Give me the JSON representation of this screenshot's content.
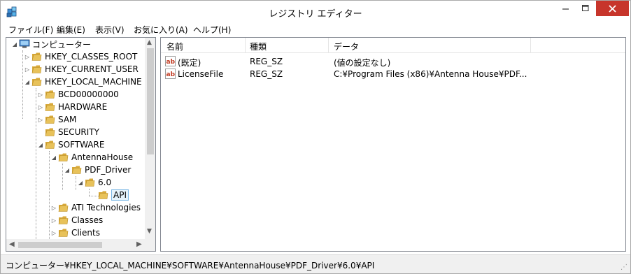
{
  "window": {
    "title": "レジストリ エディター"
  },
  "menu": {
    "items": [
      {
        "label": "ファイル(F)"
      },
      {
        "label": "編集(E)"
      },
      {
        "label": "表示(V)"
      },
      {
        "label": "お気に入り(A)"
      },
      {
        "label": "ヘルプ(H)"
      }
    ]
  },
  "tree": {
    "root": "コンピューター",
    "nodes": [
      {
        "label": "HKEY_CLASSES_ROOT",
        "expander": "▷"
      },
      {
        "label": "HKEY_CURRENT_USER",
        "expander": "▷"
      },
      {
        "label": "HKEY_LOCAL_MACHINE",
        "expander": "◢"
      },
      {
        "label": "BCD00000000",
        "expander": "▷"
      },
      {
        "label": "HARDWARE",
        "expander": "▷"
      },
      {
        "label": "SAM",
        "expander": "▷"
      },
      {
        "label": "SECURITY",
        "expander": ""
      },
      {
        "label": "SOFTWARE",
        "expander": "◢"
      },
      {
        "label": "AntennaHouse",
        "expander": "◢"
      },
      {
        "label": "PDF_Driver",
        "expander": "◢"
      },
      {
        "label": "6.0",
        "expander": "◢"
      },
      {
        "label": "API",
        "expander": ""
      },
      {
        "label": "ATI Technologies",
        "expander": "▷"
      },
      {
        "label": "Classes",
        "expander": "▷"
      },
      {
        "label": "Clients",
        "expander": "▷"
      }
    ]
  },
  "list": {
    "columns": [
      "名前",
      "種類",
      "データ"
    ],
    "rows": [
      {
        "name": "(既定)",
        "type": "REG_SZ",
        "data": "(値の設定なし)",
        "icon": "string-value-icon"
      },
      {
        "name": "LicenseFile",
        "type": "REG_SZ",
        "data": "C:¥Program Files (x86)¥Antenna House¥PDF...",
        "icon": "string-value-icon"
      }
    ]
  },
  "status": {
    "path": "コンピューター¥HKEY_LOCAL_MACHINE¥SOFTWARE¥AntennaHouse¥PDF_Driver¥6.0¥API"
  },
  "colors": {
    "close_button": "#c7352b",
    "folder": "#e8c25a",
    "selection_border": "#7ab7e5"
  }
}
